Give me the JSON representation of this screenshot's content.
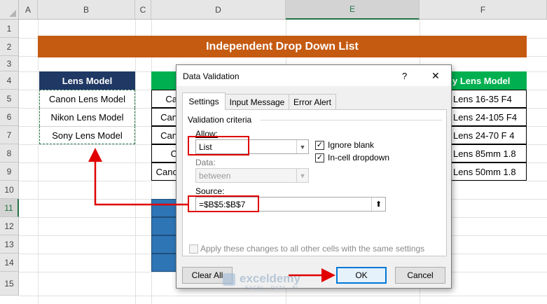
{
  "sheet": {
    "columns": [
      "A",
      "B",
      "C",
      "D",
      "E",
      "F"
    ],
    "selected_column": "E",
    "rows": [
      "1",
      "2",
      "3",
      "4",
      "5",
      "6",
      "7",
      "8",
      "9",
      "10",
      "11",
      "12",
      "13",
      "14",
      "15"
    ],
    "selected_row": "11",
    "title": "Independent Drop Down List",
    "table1": {
      "header": "Lens Model",
      "items": [
        "Canon Lens Model",
        "Nikon Lens Model",
        "Sony Lens Model"
      ]
    },
    "table2": {
      "partial_cells": [
        "Ca",
        "Can",
        "Can",
        "C",
        "Canc"
      ]
    },
    "table3": {
      "header": "y Lens Model",
      "items": [
        "Lens 16-35 F4",
        "Lens 24-105 F4",
        "Lens 24-70 F 4",
        "Lens 85mm 1.8",
        "Lens 50mm 1.8"
      ]
    }
  },
  "dialog": {
    "title": "Data Validation",
    "help": "?",
    "close": "✕",
    "tabs": [
      "Settings",
      "Input Message",
      "Error Alert"
    ],
    "active_tab": "Settings",
    "section": "Validation criteria",
    "allow_label": "Allow:",
    "allow_value": "List",
    "data_label": "Data:",
    "data_value": "between",
    "ignore_blank": "Ignore blank",
    "in_cell_dropdown": "In-cell dropdown",
    "source_label": "Source:",
    "source_value": "=$B$5:$B$7",
    "apply_all": "Apply these changes to all other cells with the same settings",
    "clear_all": "Clear All",
    "ok": "OK",
    "cancel": "Cancel"
  },
  "watermark": {
    "name": "exceldemy",
    "tagline": "EXCEL · DATA · BI"
  },
  "colors": {
    "title_bg": "#c55a11",
    "header_blue": "#1f3864",
    "header_green": "#00b050",
    "annotation_red": "#e00000",
    "dropdown_blue": "#2e75b6"
  }
}
